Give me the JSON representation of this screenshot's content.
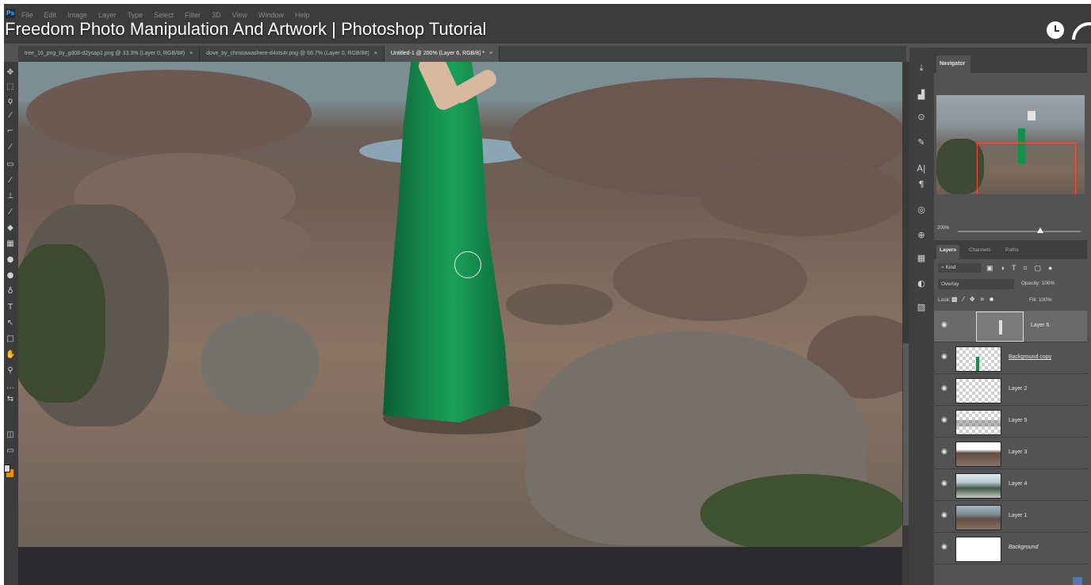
{
  "video": {
    "title": "Freedom Photo Manipulation And Artwork | Photoshop Tutorial"
  },
  "menu": [
    "File",
    "Edit",
    "Image",
    "Layer",
    "Type",
    "Select",
    "Filter",
    "3D",
    "View",
    "Window",
    "Help"
  ],
  "doc_tabs": [
    {
      "label": "tree_16_png_by_gd08-d2ysap1.png @ 33.3% (Layer 0, RGB/8#)",
      "close": "×"
    },
    {
      "label": "dove_by_christawashere-d4xts4r.png @ 66.7% (Layer 0, RGB/8#)",
      "close": "×"
    },
    {
      "label": "Untitled-1 @ 200% (Layer 6, RGB/8) *",
      "close": "×"
    }
  ],
  "navigator": {
    "tab": "Navigator",
    "zoom": "200%"
  },
  "layers_panel": {
    "tabs": [
      "Layers",
      "Channels",
      "Paths"
    ],
    "filter_kind": "Kind",
    "blend_mode": "Overlay",
    "opacity_label": "Opacity:",
    "opacity_value": "100%",
    "lock_label": "Lock:",
    "fill_label": "Fill:",
    "fill_value": "100%",
    "layers": [
      {
        "name": "Layer 6",
        "selected": true
      },
      {
        "name": "Background copy"
      },
      {
        "name": "Layer 2"
      },
      {
        "name": "Layer 5"
      },
      {
        "name": "Layer 3"
      },
      {
        "name": "Layer 4"
      },
      {
        "name": "Layer 1"
      },
      {
        "name": "Background"
      }
    ]
  },
  "colors": {
    "foreground": "#d9d9d9",
    "background": "#f28c00",
    "navigator_rect": "#ff4a3a",
    "dress": "#14904e"
  }
}
